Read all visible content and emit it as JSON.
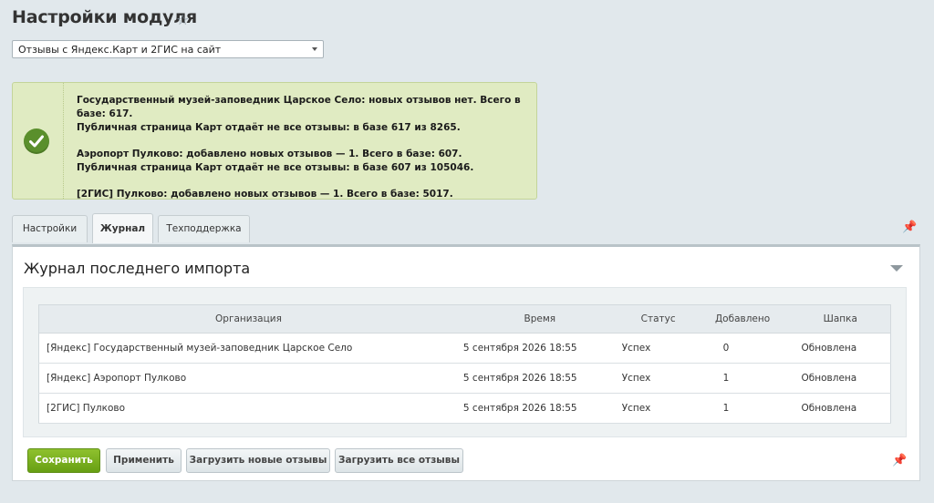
{
  "header": {
    "title": "Настройки модуля",
    "favorite_icon": "star-icon"
  },
  "module_select": {
    "value": "Отзывы с Яндекс.Карт и 2ГИС на сайт"
  },
  "notice": {
    "status": "success",
    "icon": "check-icon",
    "lines": [
      "Государственный музей-заповедник Царское Село: новых отзывов нет. Всего в базе: 617.",
      "Публичная страница Карт отдаёт не все отзывы: в базе 617 из 8265.",
      "Аэропорт Пулково: добавлено новых отзывов — 1. Всего в базе: 607.",
      "Публичная страница Карт отдаёт не все отзывы: в базе 607 из 105046.",
      "[2ГИС] Пулково: добавлено новых отзывов — 1. Всего в базе: 5017."
    ]
  },
  "tabs": [
    {
      "label": "Настройки",
      "active": false
    },
    {
      "label": "Журнал",
      "active": true
    },
    {
      "label": "Техподдержка",
      "active": false
    }
  ],
  "panel": {
    "title": "Журнал последнего импорта",
    "table": {
      "headers": [
        "Организация",
        "Время",
        "Статус",
        "Добавлено",
        "Шапка"
      ],
      "rows": [
        [
          "[Яндекс] Государственный музей-заповедник Царское Село",
          "5 сентября 2026 18:55",
          "Успех",
          "0",
          "Обновлена"
        ],
        [
          "[Яндекс] Аэропорт Пулково",
          "5 сентября 2026 18:55",
          "Успех",
          "1",
          "Обновлена"
        ],
        [
          "[2ГИС] Пулково",
          "5 сентября 2026 18:55",
          "Успех",
          "1",
          "Обновлена"
        ]
      ]
    }
  },
  "buttons": {
    "save": "Сохранить",
    "apply": "Применить",
    "load_new": "Загрузить новые отзывы",
    "load_all": "Загрузить все отзывы"
  },
  "colors": {
    "accent_green": "#679f13",
    "notice_bg": "#e0ebc2",
    "check_green": "#5a8f2c"
  }
}
